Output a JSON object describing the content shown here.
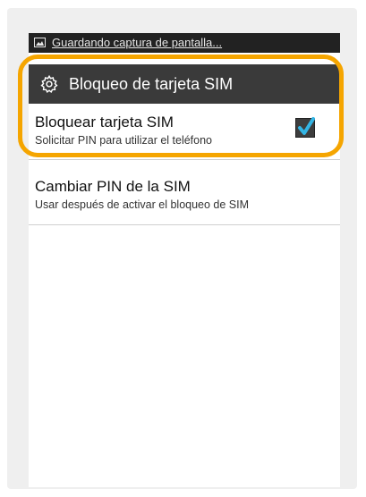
{
  "statusbar": {
    "notification_text": "Guardando captura de pantalla...",
    "icon": "image-icon"
  },
  "titlebar": {
    "title": "Bloqueo de tarjeta SIM",
    "icon": "gear-icon"
  },
  "preferences": [
    {
      "title": "Bloquear tarjeta SIM",
      "summary": "Solicitar PIN para utilizar el teléfono",
      "checked": true
    },
    {
      "title": "Cambiar PIN de la SIM",
      "summary": "Usar después de activar el bloqueo de SIM"
    }
  ],
  "colors": {
    "highlight": "#f5a500",
    "checkmark": "#33b5e5",
    "titlebar": "#3a3a3a",
    "statusbar": "#222222"
  }
}
